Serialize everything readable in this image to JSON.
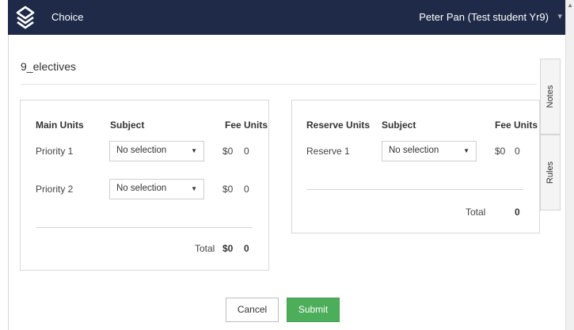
{
  "header": {
    "app_title": "Choice",
    "user_name": "Peter Pan (Test student Yr9)",
    "user_caret": "▾",
    "colors": {
      "bar": "#1e2a47",
      "text": "#ffffff"
    }
  },
  "page": {
    "title": "9_electives"
  },
  "main": {
    "headers": {
      "units": "Main Units",
      "subject": "Subject",
      "fee_units": "Fee Units"
    },
    "rows": [
      {
        "label": "Priority 1",
        "selection": "No selection",
        "fee": "$0",
        "units": "0"
      },
      {
        "label": "Priority 2",
        "selection": "No selection",
        "fee": "$0",
        "units": "0"
      }
    ],
    "total": {
      "label": "Total",
      "fee": "$0",
      "units": "0"
    }
  },
  "reserve": {
    "headers": {
      "units": "Reserve Units",
      "subject": "Subject",
      "fee_units": "Fee Units"
    },
    "rows": [
      {
        "label": "Reserve 1",
        "selection": "No selection",
        "fee": "$0",
        "units": "0"
      }
    ],
    "total": {
      "label": "Total",
      "units": "0"
    }
  },
  "side_tabs": {
    "notes": "Notes",
    "rules": "Rules"
  },
  "actions": {
    "cancel": "Cancel",
    "submit": "Submit",
    "submit_color": "#4cae5b"
  }
}
